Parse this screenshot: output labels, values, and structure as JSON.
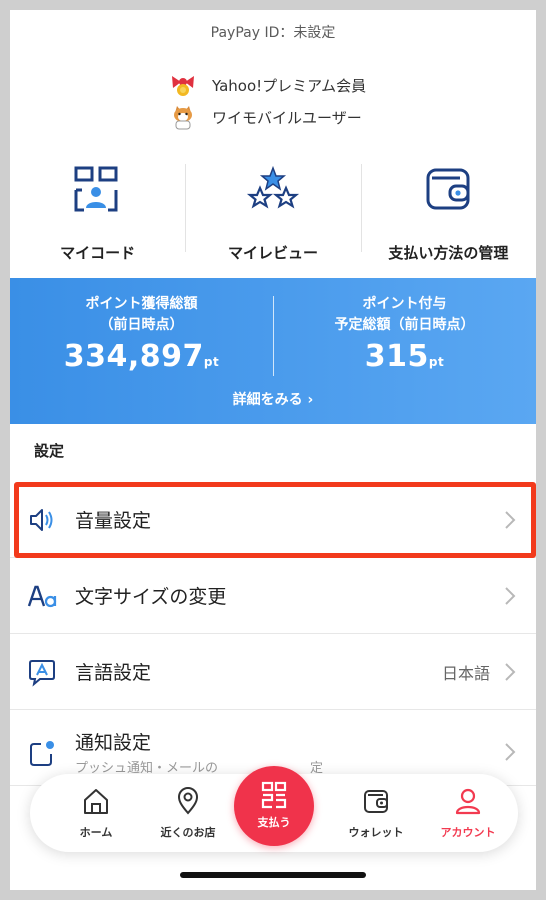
{
  "header": {
    "paypay_id": "PayPay ID：未設定"
  },
  "badges": [
    {
      "label": "Yahoo!プレミアム会員",
      "icon": "ribbon-medal-icon"
    },
    {
      "label": "ワイモバイルユーザー",
      "icon": "cat-mascot-icon"
    }
  ],
  "quick_actions": [
    {
      "label": "マイコード",
      "icon": "qr-user-icon"
    },
    {
      "label": "マイレビュー",
      "icon": "stars-icon"
    },
    {
      "label": "支払い方法の管理",
      "icon": "wallet-icon"
    }
  ],
  "points": {
    "total_label_1": "ポイント獲得総額",
    "total_label_2": "（前日時点）",
    "total_value": "334,897",
    "scheduled_label_1": "ポイント付与",
    "scheduled_label_2": "予定総額（前日時点）",
    "scheduled_value": "315",
    "unit": "pt",
    "more_link": "詳細をみる ›",
    "gradient_start": "#3a8fe6",
    "gradient_end": "#5aa7f2"
  },
  "settings": {
    "title": "設定",
    "items": [
      {
        "label": "音量設定",
        "icon": "speaker-icon",
        "value": ""
      },
      {
        "label": "文字サイズの変更",
        "icon": "text-size-icon",
        "value": ""
      },
      {
        "label": "言語設定",
        "icon": "language-icon",
        "value": "日本語"
      },
      {
        "label": "通知設定",
        "icon": "notification-icon",
        "value": "",
        "subtitle": "プッシュ通知・メールの",
        "subtitle_suffix": "定"
      }
    ]
  },
  "tabbar": {
    "tabs": [
      {
        "label": "ホーム",
        "icon": "home-icon"
      },
      {
        "label": "近くのお店",
        "icon": "location-pin-icon"
      },
      {
        "label": "支払う",
        "icon": "qr-pay-icon"
      },
      {
        "label": "ウォレット",
        "icon": "wallet-icon"
      },
      {
        "label": "アカウント",
        "icon": "person-icon",
        "active": true
      }
    ]
  },
  "colors": {
    "accent_red": "#f0334b",
    "highlight": "#f23a1c",
    "brand_blue": "#1d3f82"
  }
}
